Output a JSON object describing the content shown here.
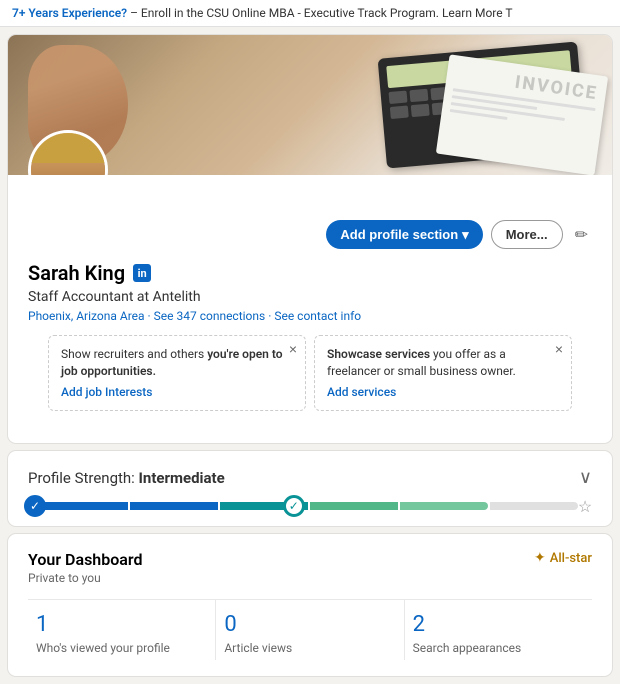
{
  "banner": {
    "text": "7+ Years Experience? – Enroll in the CSU Online MBA - Executive Track Program. Learn More",
    "highlight": "7+ Years Experience?"
  },
  "profile": {
    "name": "Sarah King",
    "title": "Staff Accountant at Antelith",
    "location": "Phoenix, Arizona Area",
    "connections": "See 347 connections",
    "contact": "See contact info",
    "avatar_alt": "Sarah King profile photo",
    "linkedin_badge": "in",
    "green_badge": "✓"
  },
  "actions": {
    "add_section_label": "Add profile section",
    "more_label": "More...",
    "edit_icon": "✏"
  },
  "notifications": {
    "left": {
      "text_before_bold": "Show recruiters and others ",
      "bold": "you're open to job opportunities.",
      "link": "Add job Interests"
    },
    "right": {
      "text_before_bold": "Showcase services ",
      "bold": "you offer as a freelancer or small business owner.",
      "link": "Add services"
    }
  },
  "strength": {
    "label": "Profile Strength: ",
    "level": "Intermediate",
    "chevron": "∨"
  },
  "dashboard": {
    "title": "Your Dashboard",
    "private_text": "Private to you",
    "allstar_label": "All-star",
    "stats": [
      {
        "number": "1",
        "label": "Who's viewed your profile"
      },
      {
        "number": "0",
        "label": "Article views"
      },
      {
        "number": "2",
        "label": "Search appearances"
      }
    ]
  }
}
